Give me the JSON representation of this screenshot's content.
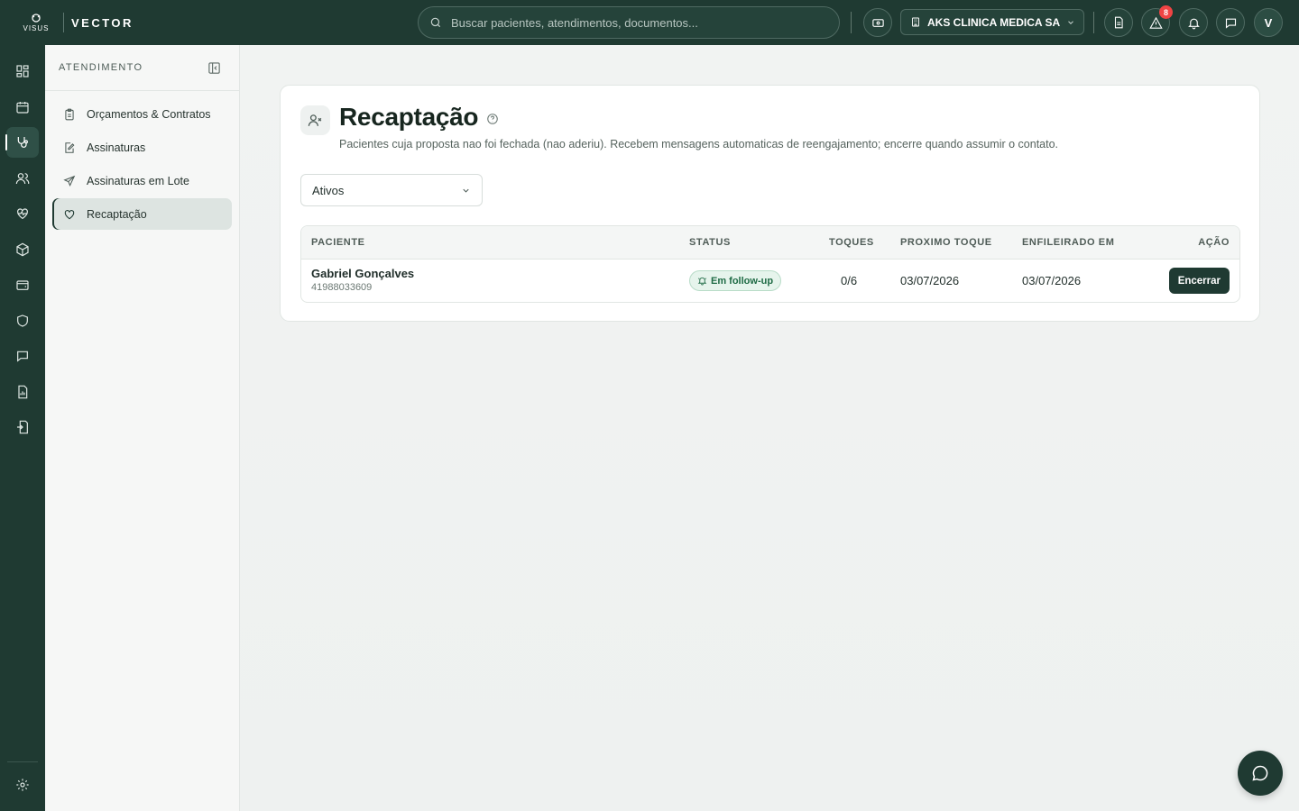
{
  "brand": {
    "logo_text": "VISUS",
    "product": "VECTOR"
  },
  "search": {
    "placeholder": "Buscar pacientes, atendimentos, documentos..."
  },
  "clinic": {
    "name": "AKS CLINICA MEDICA SA"
  },
  "alerts": {
    "count": "8"
  },
  "user": {
    "initial": "V"
  },
  "sidebar": {
    "title": "ATENDIMENTO",
    "items": [
      {
        "label": "Orçamentos & Contratos",
        "icon": "clipboard-icon"
      },
      {
        "label": "Assinaturas",
        "icon": "signature-icon"
      },
      {
        "label": "Assinaturas em Lote",
        "icon": "send-icon"
      },
      {
        "label": "Recaptação",
        "icon": "heart-icon",
        "active": true
      }
    ]
  },
  "page": {
    "title": "Recaptação",
    "subtitle": "Pacientes cuja proposta nao foi fechada (nao aderiu). Recebem mensagens automaticas de reengajamento; encerre quando assumir o contato."
  },
  "filter": {
    "selected": "Ativos"
  },
  "table": {
    "headers": [
      "PACIENTE",
      "STATUS",
      "TOQUES",
      "PROXIMO TOQUE",
      "ENFILEIRADO EM",
      "AÇÃO"
    ],
    "rows": [
      {
        "name": "Gabriel Gonçalves",
        "phone": "41988033609",
        "status": "Em follow-up",
        "touches": "0/6",
        "next_touch": "03/07/2026",
        "queued_at": "03/07/2026",
        "action": "Encerrar"
      }
    ]
  },
  "colors": {
    "primary": "#1f3a32",
    "status_bg": "#e6f4ec",
    "status_text": "#1f6b45",
    "badge": "#ef4444"
  }
}
